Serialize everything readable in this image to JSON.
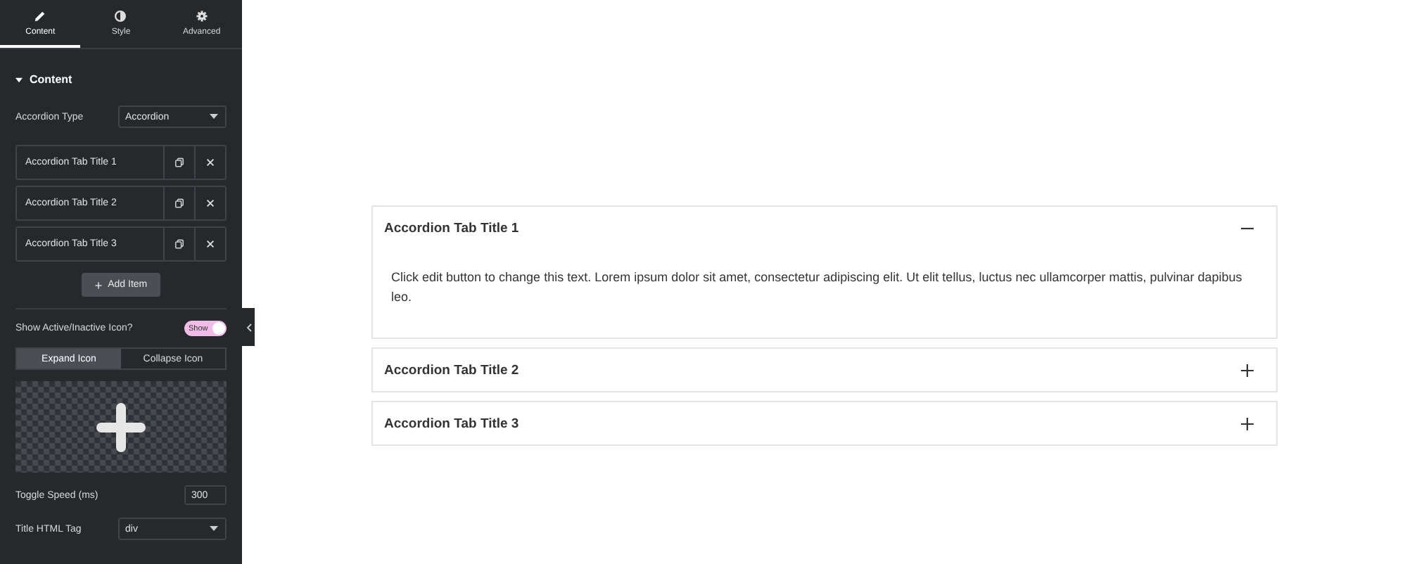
{
  "sidebar": {
    "tabs": [
      {
        "label": "Content",
        "selected": true
      },
      {
        "label": "Style",
        "selected": false
      },
      {
        "label": "Advanced",
        "selected": false
      }
    ],
    "section": {
      "title": "Content",
      "expanded": true
    },
    "accordion_type": {
      "label": "Accordion Type",
      "value": "Accordion"
    },
    "items": [
      {
        "title": "Accordion Tab Title 1"
      },
      {
        "title": "Accordion Tab Title 2"
      },
      {
        "title": "Accordion Tab Title 3"
      }
    ],
    "add_button": {
      "icon": "+",
      "label": "Add Item"
    },
    "icon_toggle": {
      "label": "Show Active/Inactive Icon?",
      "on": true,
      "text": "Show"
    },
    "icon_tabs": [
      {
        "label": "Expand Icon",
        "selected": true
      },
      {
        "label": "Collapse Icon",
        "selected": false
      }
    ],
    "toggle_speed": {
      "label": "Toggle Speed (ms)",
      "value": "300"
    },
    "title_tag": {
      "label": "Title HTML Tag",
      "value": "div"
    }
  },
  "accordion": [
    {
      "title": "Accordion Tab Title 1",
      "expanded": true,
      "content": "Click edit button to change this text. Lorem ipsum dolor sit amet, consectetur adipiscing elit. Ut elit tellus, luctus nec ullamcorper mattis, pulvinar dapibus leo."
    },
    {
      "title": "Accordion Tab Title 2",
      "expanded": false
    },
    {
      "title": "Accordion Tab Title 3",
      "expanded": false
    }
  ]
}
